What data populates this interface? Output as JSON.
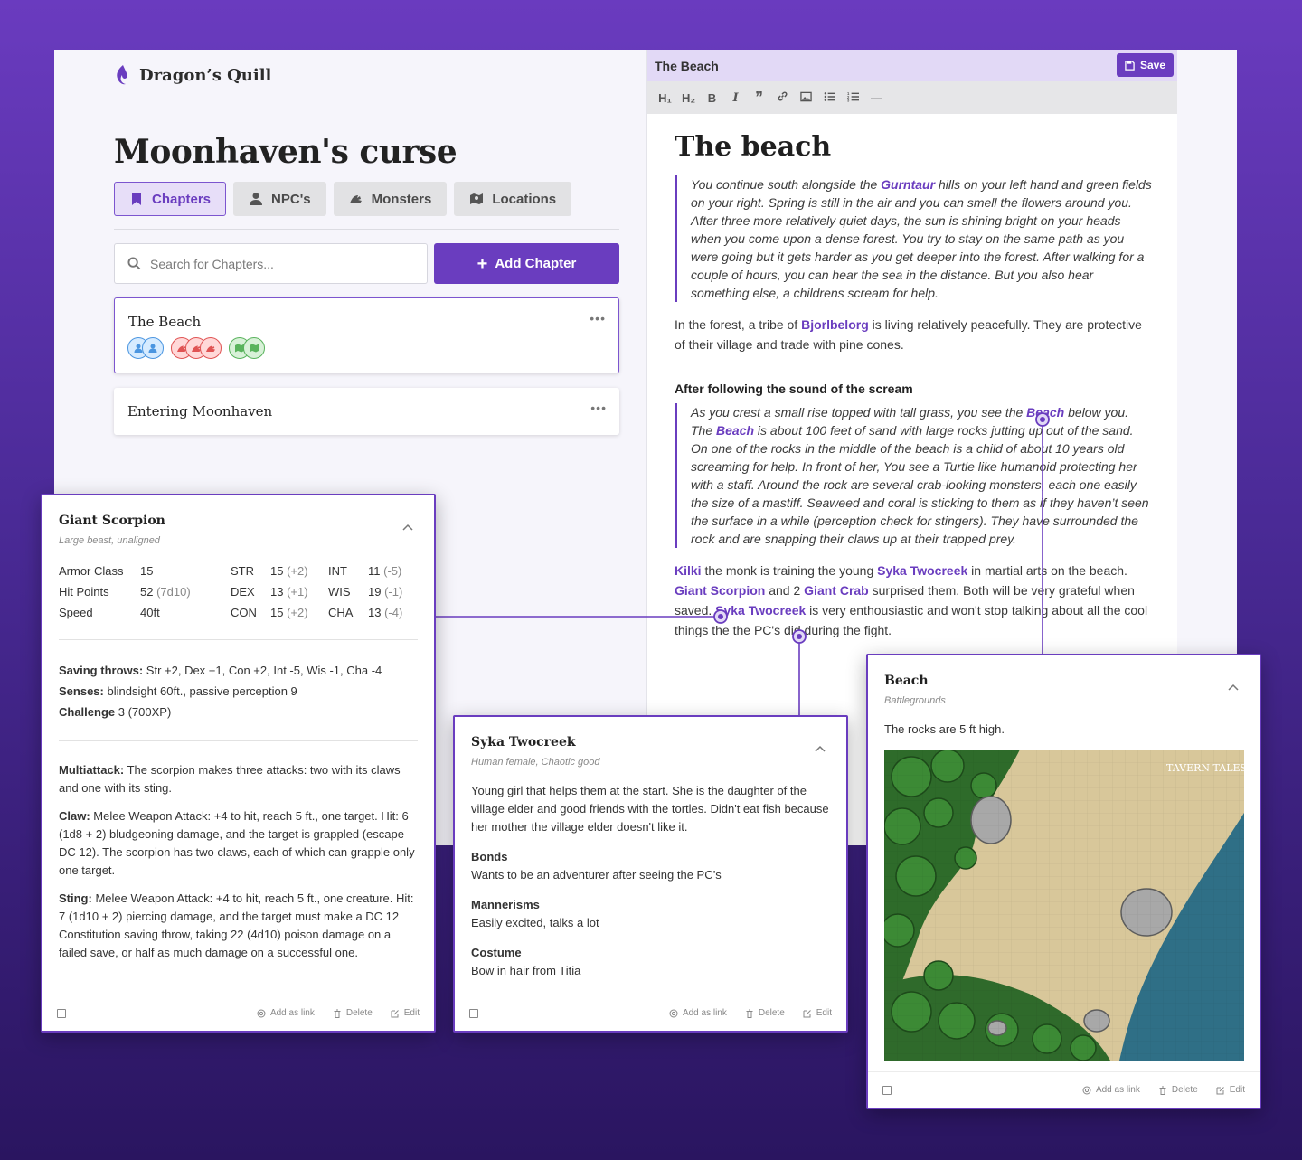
{
  "app": {
    "name": "Dragon’s Quill"
  },
  "campaign": {
    "title": "Moonhaven's curse"
  },
  "tabs": [
    {
      "label": "Chapters",
      "icon": "bookmark-icon",
      "active": true
    },
    {
      "label": "NPC's",
      "icon": "person-icon",
      "active": false
    },
    {
      "label": "Monsters",
      "icon": "monster-icon",
      "active": false
    },
    {
      "label": "Locations",
      "icon": "map-icon",
      "active": false
    }
  ],
  "search": {
    "placeholder": "Search for Chapters..."
  },
  "add_chapter_label": "Add Chapter",
  "chapters": [
    {
      "title": "The Beach",
      "more": "•••"
    },
    {
      "title": "Entering Moonhaven",
      "more": "•••"
    }
  ],
  "editor": {
    "chapter_name": "The Beach",
    "save_label": "Save",
    "toolbar": [
      "H₁",
      "H₂",
      "B",
      "I",
      "”",
      "link",
      "image",
      "bullet-list",
      "numbered-list",
      "—"
    ],
    "title": "The beach",
    "quote1": {
      "a": "You continue south alongside the ",
      "link": "Gurntaur",
      "b": " hills on your left hand and green fields on your right. Spring is still in the air and you can smell the flowers around you. After three more relatively quiet days, the sun is shining bright on your heads when you come upon a dense forest. You try to stay on the same path as you were going but it gets harder as you get deeper into the forest. After walking for a couple of hours, you can hear the sea in the distance. But you also hear something else, a childrens scream for help."
    },
    "para1": {
      "a": "In the forest, a tribe of ",
      "link": "Bjorlbelorg",
      "b": " is living relatively peacefully. They are protective of their village and trade with pine cones."
    },
    "subheading": "After following the sound of the scream",
    "quote2": {
      "a": "As you crest a small rise topped with tall grass, you see the ",
      "link1": "Beach",
      "b": " below you. The ",
      "link2": "Beach",
      "c": " is about 100 feet of sand with large rocks jutting up out of the sand. On one of the rocks in the middle of the beach is a child of about 10 years old screaming for help. In front of her, You see a Turtle like humanoid protecting her with a staff. Around the rock are several crab-looking monsters, each one easily the size of a mastiff. Seaweed and coral is sticking to them as if  they haven’t seen the surface in a while (perception check for stingers). They have surrounded the rock and are snapping their claws up at their trapped prey."
    },
    "para2": {
      "link1": "Kilki",
      "a": " the monk is training the young ",
      "link2": "Syka Twocreek",
      "b": " in martial arts on the beach. ",
      "link3": "Giant Scorpion",
      "c": " and 2 ",
      "link4": "Giant Crab",
      "d": " surprised them. Both will be very grateful when saved. ",
      "link5": "Syka Twocreek",
      "e": " is very enthousiastic and won't stop talking about all the cool things the the PC's did during the fight."
    }
  },
  "scorpion": {
    "name": "Giant Scorpion",
    "subtitle": "Large beast, unaligned",
    "stats": {
      "ac_label": "Armor Class",
      "ac": "15",
      "hp_label": "Hit Points",
      "hp": "52",
      "hp_dice": "(7d10)",
      "speed_label": "Speed",
      "speed": "40ft",
      "str_label": "STR",
      "str": "15",
      "str_mod": "(+2)",
      "dex_label": "DEX",
      "dex": "13",
      "dex_mod": "(+1)",
      "con_label": "CON",
      "con": "15",
      "con_mod": "(+2)",
      "int_label": "INT",
      "int": "11",
      "int_mod": "(-5)",
      "wis_label": "WIS",
      "wis": "19",
      "wis_mod": "(-1)",
      "cha_label": "CHA",
      "cha": "13",
      "cha_mod": "(-4)"
    },
    "saving_label": "Saving throws:",
    "saving": " Str +2, Dex +1, Con +2, Int -5, Wis -1, Cha -4",
    "senses_label": "Senses:",
    "senses": " blindsight 60ft., passive perception 9",
    "challenge_label": "Challenge",
    "challenge": " 3 (700XP)",
    "multi_label": "Multiattack:",
    "multi": " The scorpion makes three attacks: two with its claws and one with its sting.",
    "claw_label": "Claw:",
    "claw": " Melee Weapon Attack: +4 to hit, reach 5 ft., one target. Hit: 6 (1d8 + 2) bludgeoning damage, and the target is grappled (escape DC 12). The scorpion has two claws, each of which can grapple only one target.",
    "sting_label": "Sting:",
    "sting": " Melee Weapon Attack: +4 to hit, reach 5 ft., one creature. Hit: 7 (1d10 + 2) piercing damage, and the target must make a DC 12 Constitution saving throw, taking 22 (4d10) poison damage on a failed save, or half as much damage on a successful one."
  },
  "syka": {
    "name": "Syka Twocreek",
    "subtitle": "Human female, Chaotic good",
    "description": "Young girl that helps them at the start. She is the daughter of the village elder and good friends with the tortles. Didn't eat fish because her mother the village elder doesn't like it.",
    "bonds_label": "Bonds",
    "bonds": "Wants to be an adventurer after seeing the PC’s",
    "mannerisms_label": "Mannerisms",
    "mannerisms": "Easily excited, talks a lot",
    "costume_label": "Costume",
    "costume": "Bow in hair from Titia"
  },
  "beach": {
    "name": "Beach",
    "subtitle": "Battlegrounds",
    "description": "The rocks are 5 ft high.",
    "map_watermark": "TAVERN TALES"
  },
  "footer": {
    "add_link": "Add as link",
    "delete": "Delete",
    "edit": "Edit"
  },
  "colors": {
    "accent": "#6a3dbf",
    "accent_light": "#e2d9f6",
    "blue": "#4a95e0",
    "red": "#e05353",
    "green": "#59b35c"
  }
}
